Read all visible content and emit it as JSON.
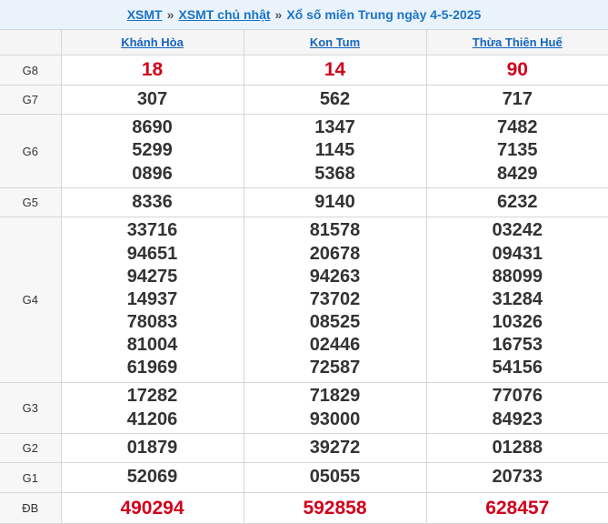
{
  "breadcrumb": {
    "home": "XSMT",
    "separator": "»",
    "day_link": "XSMT chủ nhật",
    "current": "Xổ số miền Trung ngày 4-5-2025"
  },
  "provinces": [
    "Khánh Hòa",
    "Kon Tum",
    "Thừa Thiên Huế"
  ],
  "colors": {
    "link": "#1565c0",
    "special": "#d0011b",
    "header_bg": "#eaf3fb"
  },
  "prizes": {
    "g8": {
      "label": "G8",
      "values": [
        [
          "18"
        ],
        [
          "14"
        ],
        [
          "90"
        ]
      ]
    },
    "g7": {
      "label": "G7",
      "values": [
        [
          "307"
        ],
        [
          "562"
        ],
        [
          "717"
        ]
      ]
    },
    "g6": {
      "label": "G6",
      "values": [
        [
          "8690",
          "5299",
          "0896"
        ],
        [
          "1347",
          "1145",
          "5368"
        ],
        [
          "7482",
          "7135",
          "8429"
        ]
      ]
    },
    "g5": {
      "label": "G5",
      "values": [
        [
          "8336"
        ],
        [
          "9140"
        ],
        [
          "6232"
        ]
      ]
    },
    "g4": {
      "label": "G4",
      "values": [
        [
          "33716",
          "94651",
          "94275",
          "14937",
          "78083",
          "81004",
          "61969"
        ],
        [
          "81578",
          "20678",
          "94263",
          "73702",
          "08525",
          "02446",
          "72587"
        ],
        [
          "03242",
          "09431",
          "88099",
          "31284",
          "10326",
          "16753",
          "54156"
        ]
      ]
    },
    "g3": {
      "label": "G3",
      "values": [
        [
          "17282",
          "41206"
        ],
        [
          "71829",
          "93000"
        ],
        [
          "77076",
          "84923"
        ]
      ]
    },
    "g2": {
      "label": "G2",
      "values": [
        [
          "01879"
        ],
        [
          "39272"
        ],
        [
          "01288"
        ]
      ]
    },
    "g1": {
      "label": "G1",
      "values": [
        [
          "52069"
        ],
        [
          "05055"
        ],
        [
          "20733"
        ]
      ]
    },
    "db": {
      "label": "ĐB",
      "values": [
        [
          "490294"
        ],
        [
          "592858"
        ],
        [
          "628457"
        ]
      ]
    }
  }
}
